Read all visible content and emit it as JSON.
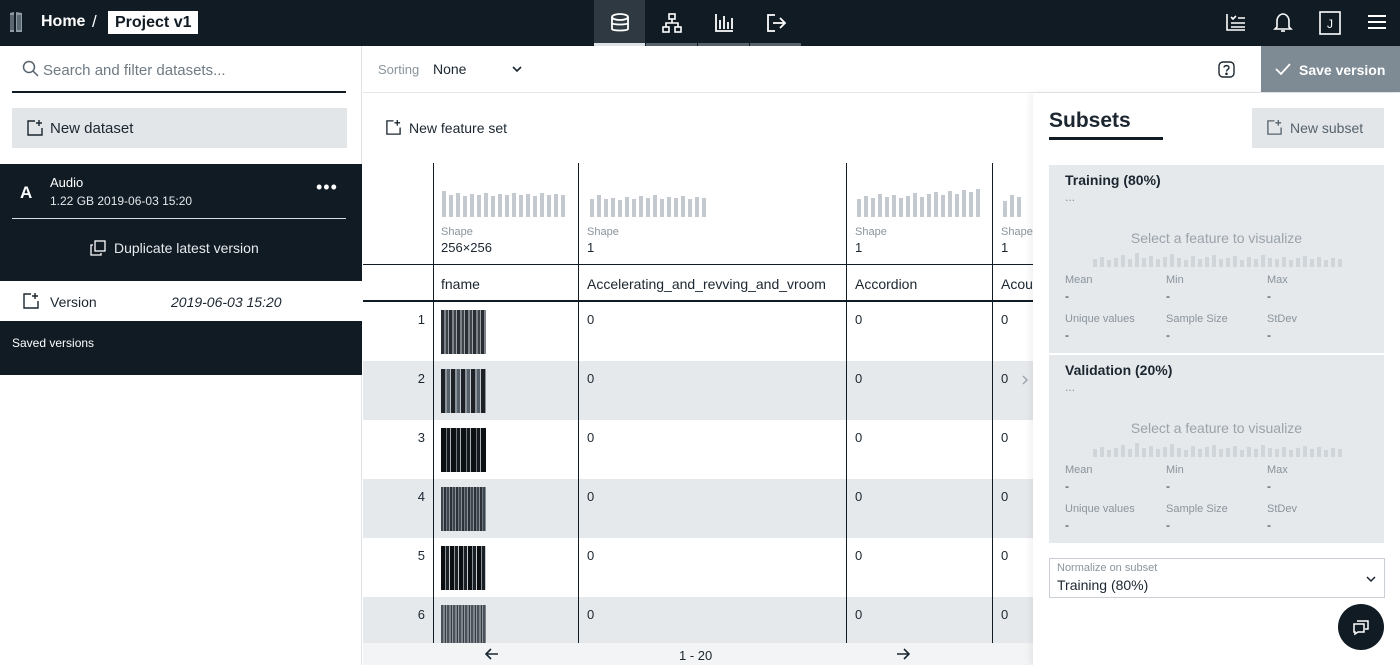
{
  "topbar": {
    "logo_icon": "platform-logo-icon",
    "breadcrumb_home": "Home",
    "breadcrumb_sep": "/",
    "breadcrumb_project": "Project v1",
    "nav_tabs": [
      {
        "icon": "datasets-icon",
        "active": true
      },
      {
        "icon": "model-graph-icon",
        "active": false
      },
      {
        "icon": "evaluation-chart-icon",
        "active": false
      },
      {
        "icon": "deployment-icon",
        "active": false
      }
    ],
    "right_icons": [
      "jobs-list-icon",
      "notifications-bell-icon",
      "user-avatar-icon",
      "hamburger-menu-icon"
    ],
    "avatar_letter": "J"
  },
  "left_panel": {
    "search_placeholder": "Search and filter datasets...",
    "new_dataset_label": "New dataset",
    "dataset": {
      "badge": "A",
      "name": "Audio",
      "meta": "1.22 GB 2019-06-03 15:20",
      "more": "•••"
    },
    "duplicate_label": "Duplicate latest version",
    "version_label": "Version",
    "version_date": "2019-06-03 15:20",
    "saved_versions_label": "Saved versions"
  },
  "toolbar": {
    "sorting_label": "Sorting",
    "sorting_value": "None",
    "save_version_label": "Save version"
  },
  "main": {
    "new_feature_set_label": "New feature set",
    "columns": [
      {
        "name": "fname",
        "shape_label": "Shape",
        "shape": "256×256"
      },
      {
        "name": "Accelerating_and_revving_and_vroom",
        "shape_label": "Shape",
        "shape": "1"
      },
      {
        "name": "Accordion",
        "shape_label": "Shape",
        "shape": "1"
      },
      {
        "name": "Acou",
        "shape_label": "Shape",
        "shape": "1"
      }
    ],
    "rows": [
      {
        "index": "1",
        "values": [
          "0",
          "0",
          "0"
        ]
      },
      {
        "index": "2",
        "values": [
          "0",
          "0",
          "0"
        ]
      },
      {
        "index": "3",
        "values": [
          "0",
          "0",
          "0"
        ]
      },
      {
        "index": "4",
        "values": [
          "0",
          "0",
          "0"
        ]
      },
      {
        "index": "5",
        "values": [
          "0",
          "0",
          "0"
        ]
      },
      {
        "index": "6",
        "values": [
          "0",
          "0",
          "0"
        ]
      }
    ],
    "pagination": "1 - 20"
  },
  "subsets": {
    "title": "Subsets",
    "new_subset_label": "New subset",
    "cards": [
      {
        "title": "Training (80%)",
        "dots": "...",
        "hint": "Select a feature to visualize",
        "stats": {
          "mean": "Mean",
          "min": "Min",
          "max": "Max",
          "unique": "Unique values",
          "sample": "Sample Size",
          "stdev": "StDev",
          "empty": "-"
        }
      },
      {
        "title": "Validation (20%)",
        "dots": "...",
        "hint": "Select a feature to visualize",
        "stats": {
          "mean": "Mean",
          "min": "Min",
          "max": "Max",
          "unique": "Unique values",
          "sample": "Sample Size",
          "stdev": "StDev",
          "empty": "-"
        }
      }
    ],
    "normalize_label": "Normalize on subset",
    "normalize_value": "Training (80%)"
  },
  "colors": {
    "dark_navy": "#101b24",
    "tab_active": "#2e3942",
    "save_button": "#7e8a94",
    "row_alt": "#e6e9ec",
    "card_bg": "#e6e9ec"
  }
}
